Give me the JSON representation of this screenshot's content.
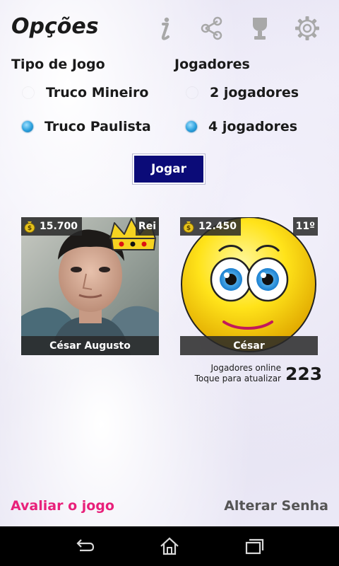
{
  "header": {
    "title": "Opções",
    "icons": [
      "info-icon",
      "share-icon",
      "trophy-icon",
      "settings-gear-icon"
    ]
  },
  "game_type": {
    "heading": "Tipo de Jogo",
    "options": [
      {
        "label": "Truco Mineiro",
        "selected": false
      },
      {
        "label": "Truco Paulista",
        "selected": true
      }
    ]
  },
  "players": {
    "heading": "Jogadores",
    "options": [
      {
        "label": "2 jogadores",
        "selected": false
      },
      {
        "label": "4 jogadores",
        "selected": true
      }
    ]
  },
  "play_button": "Jogar",
  "cards": [
    {
      "coins": "15.700",
      "rank": "Rei",
      "name": "César Augusto",
      "avatar": "user-photo"
    },
    {
      "coins": "12.450",
      "rank": "11º",
      "name": "César",
      "avatar": "smiley-face"
    }
  ],
  "online": {
    "line1": "Jogadores online",
    "line2": "Toque para atualizar",
    "count": "223"
  },
  "footer": {
    "rate_label": "Avaliar o jogo",
    "password_label": "Alterar Senha"
  },
  "colors": {
    "accent_pink": "#e8207a",
    "button_navy": "#0b0b78",
    "radio_blue": "#2aa0dd"
  }
}
